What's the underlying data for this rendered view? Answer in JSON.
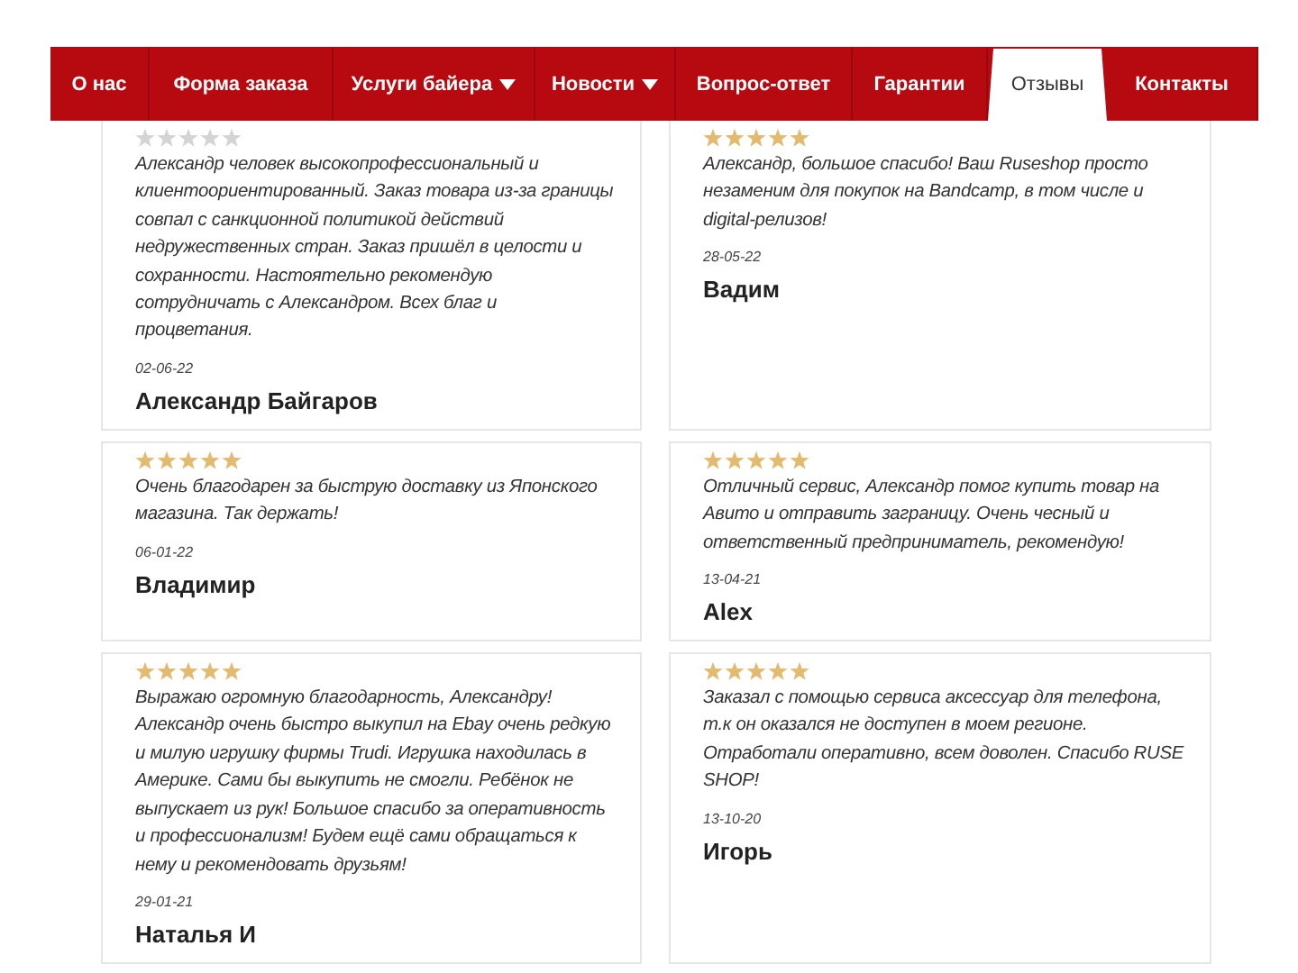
{
  "nav": [
    {
      "label": "О нас",
      "has_dropdown": false,
      "selected": false
    },
    {
      "label": "Форма заказа",
      "has_dropdown": false,
      "selected": false
    },
    {
      "label": "Услуги байера",
      "has_dropdown": true,
      "selected": false
    },
    {
      "label": "Новости",
      "has_dropdown": true,
      "selected": false
    },
    {
      "label": "Вопрос-ответ",
      "has_dropdown": false,
      "selected": false
    },
    {
      "label": "Гарантии",
      "has_dropdown": false,
      "selected": false
    },
    {
      "label": "Отзывы",
      "has_dropdown": false,
      "selected": true
    },
    {
      "label": "Контакты",
      "has_dropdown": false,
      "selected": false
    }
  ],
  "reviews": [
    {
      "stars": 0,
      "text": "Александр человек высокопрофессиональный и клиентоориентированный. Заказ товара из-за границы совпал с санкционной политикой действий недружественных стран. Заказ пришёл в целости и сохранности. Настоятельно рекомендую сотрудничать с Александром. Всех благ и процветания.",
      "date": "02-06-22",
      "author": "Александр Байгаров"
    },
    {
      "stars": 5,
      "text": "Александр, большое спасибо! Ваш Ruseshop просто незаменим для покупок на Bandcamp, в том числе и digital-релизов!",
      "date": "28-05-22",
      "author": "Вадим"
    },
    {
      "stars": 5,
      "text": "Очень благодарен за быструю доставку из Японского магазина. Так держать!",
      "date": "06-01-22",
      "author": "Владимир"
    },
    {
      "stars": 5,
      "text": "Отличный сервис, Александр помог купить товар на Авито и отправить заграницу. Очень чесный и ответственный предприниматель, рекомендую!",
      "date": "13-04-21",
      "author": "Alex"
    },
    {
      "stars": 5,
      "text": "Выражаю огромную благодарность, Александру! Александр очень быстро выкупил на Ebay очень редкую и милую игрушку фирмы Trudi. Игрушка находилась в Америке. Сами бы выкупить не смогли. Ребёнок не выпускает из рук! Большое спасибо за оперативность и профессионализм! Будем ещё сами обращаться к нему и рекомендовать друзьям!",
      "date": "29-01-21",
      "author": "Наталья И"
    },
    {
      "stars": 5,
      "text": "Заказал с помощью сервиса аксессуар для телефона, т.к он оказался не доступен в моем регионе. Отработали оперативно, всем доволен. Спасибо RUSE SHOP!",
      "date": "13-10-20",
      "author": "Игорь"
    }
  ]
}
